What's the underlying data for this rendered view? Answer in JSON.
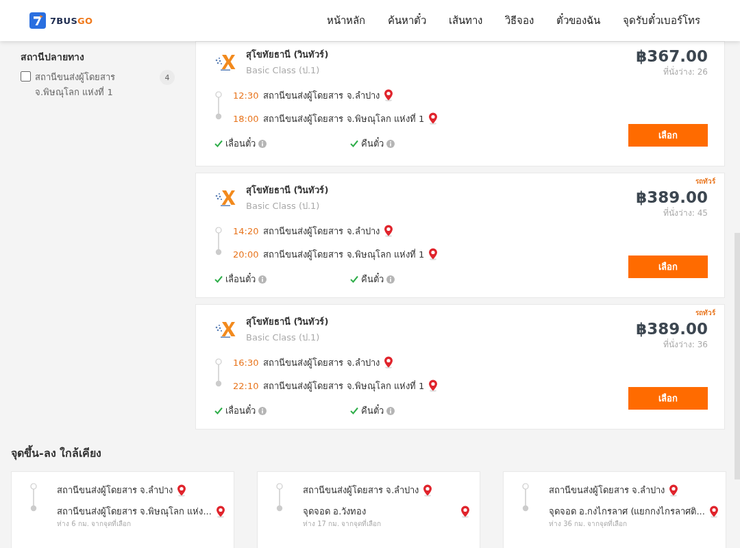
{
  "header": {
    "logo": {
      "part_1": "7BUS",
      "part_2": "GO"
    },
    "nav": [
      {
        "label": "หน้าหลัก"
      },
      {
        "label": "ค้นหาตั๋ว"
      },
      {
        "label": "เส้นทาง"
      },
      {
        "label": "วิธีจอง"
      },
      {
        "label": "ตั๋วของฉัน"
      },
      {
        "label": "จุดรับตั๋วเบอร์โทร"
      }
    ]
  },
  "filter": {
    "title": "สถานีปลายทาง",
    "options": [
      {
        "label": "สถานีขนส่งผู้โดยสาร จ.พิษณุโลก แห่งที่ 1",
        "count": "4",
        "checked": false
      }
    ]
  },
  "trips": [
    {
      "operator": "สุโขทัยธานี (วินทัวร์)",
      "class": "Basic Class (ป.1)",
      "price": "฿367.00",
      "seats": "ที่นั่งว่าง: 26",
      "stops": [
        {
          "time": "12:30",
          "station": "สถานีขนส่งผู้โดยสาร จ.ลำปาง"
        },
        {
          "time": "18:00",
          "station": "สถานีขนส่งผู้โดยสาร จ.พิษณุโลก แห่งที่ 1"
        }
      ],
      "features": [
        {
          "label": "เลื่อนตั๋ว",
          "available": true
        },
        {
          "label": "คืนตั๋ว",
          "available": true
        }
      ],
      "button": "เลือก"
    },
    {
      "tag": "รถทัวร์",
      "operator": "สุโขทัยธานี (วินทัวร์)",
      "class": "Basic Class (ป.1)",
      "price": "฿389.00",
      "seats": "ที่นั่งว่าง: 45",
      "stops": [
        {
          "time": "14:20",
          "station": "สถานีขนส่งผู้โดยสาร จ.ลำปาง"
        },
        {
          "time": "20:00",
          "station": "สถานีขนส่งผู้โดยสาร จ.พิษณุโลก แห่งที่ 1"
        }
      ],
      "features": [
        {
          "label": "เลื่อนตั๋ว",
          "available": true
        },
        {
          "label": "คืนตั๋ว",
          "available": true
        }
      ],
      "button": "เลือก"
    },
    {
      "tag": "รถทัวร์",
      "operator": "สุโขทัยธานี (วินทัวร์)",
      "class": "Basic Class (ป.1)",
      "price": "฿389.00",
      "seats": "ที่นั่งว่าง: 36",
      "stops": [
        {
          "time": "16:30",
          "station": "สถานีขนส่งผู้โดยสาร จ.ลำปาง"
        },
        {
          "time": "22:10",
          "station": "สถานีขนส่งผู้โดยสาร จ.พิษณุโลก แห่งที่ 1"
        }
      ],
      "features": [
        {
          "label": "เลื่อนตั๋ว",
          "available": true
        },
        {
          "label": "คืนตั๋ว",
          "available": true
        }
      ],
      "button": "เลือก"
    }
  ],
  "nearby": {
    "title": "จุดขึ้น-ลง ใกล้เคียง",
    "cards": [
      {
        "from": "สถานีขนส่งผู้โดยสาร จ.ลำปาง",
        "to": "สถานีขนส่งผู้โดยสาร จ.พิษณุโลก แห่ง...",
        "distance": "ห่าง 6 กม. จากจุดที่เลือก"
      },
      {
        "from": "สถานีขนส่งผู้โดยสาร จ.ลำปาง",
        "to": "จุดจอด อ.วังทอง",
        "distance": "ห่าง 17 กม. จากจุดที่เลือก"
      },
      {
        "from": "สถานีขนส่งผู้โดยสาร จ.ลำปาง",
        "to": "จุดจอด อ.กงไกรลาศ (แยกกงไกรลาศติ...",
        "distance": "ห่าง 36 กม. จากจุดที่เลือก"
      }
    ]
  }
}
